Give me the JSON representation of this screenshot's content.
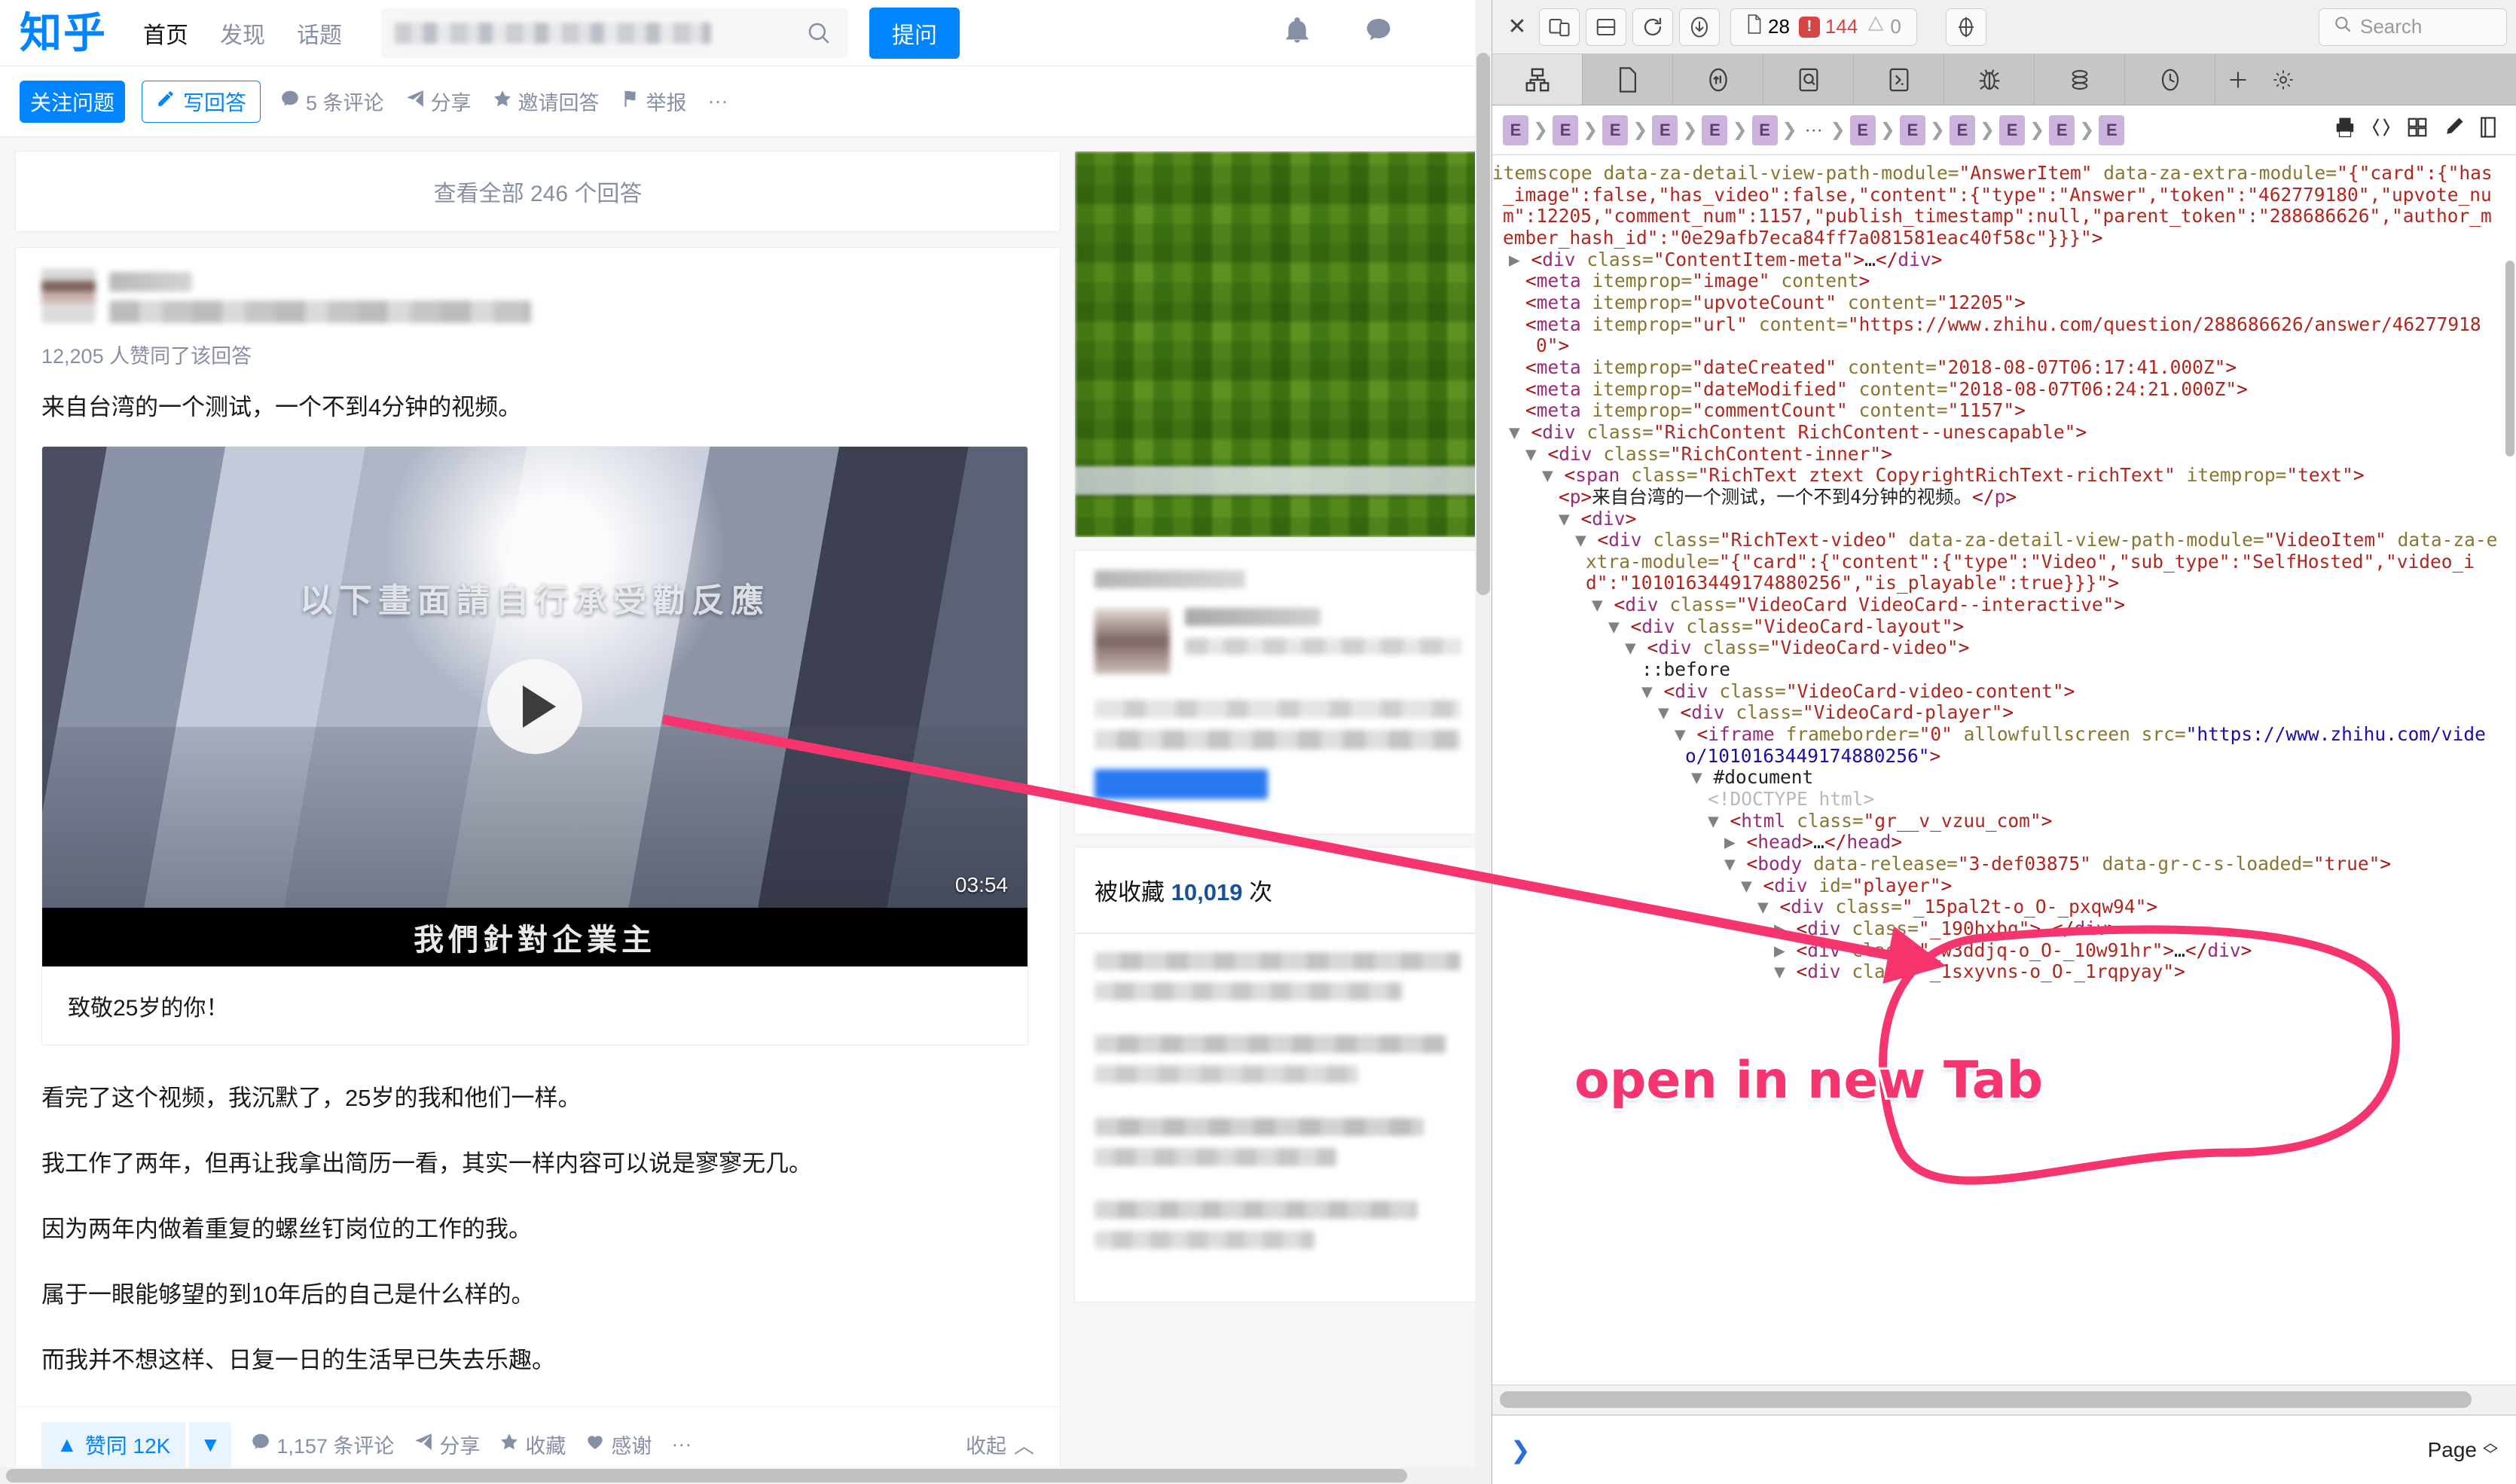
{
  "zhihu": {
    "logo": "知乎",
    "nav": [
      {
        "label": "首页",
        "active": true
      },
      {
        "label": "发现",
        "active": false
      },
      {
        "label": "话题",
        "active": false
      }
    ],
    "search": {
      "placeholder": "",
      "value": ""
    },
    "ask_button": "提问",
    "action_bar": {
      "follow": "关注问题",
      "write": "写回答",
      "comments": "5 条评论",
      "share": "分享",
      "invite": "邀请回答",
      "report": "举报",
      "more": "···"
    },
    "view_all": "查看全部 246 个回答",
    "answer": {
      "upvote_line": "12,205 人赞同了该回答",
      "lead": "来自台湾的一个测试，一个不到4分钟的视频。",
      "video": {
        "overlay_subtitle": "以下畫面請自行承受勸反應",
        "title_bar": "我們針對企業主",
        "duration": "03:54",
        "caption": "致敬25岁的你！"
      },
      "paragraphs": [
        "看完了这个视频，我沉默了，25岁的我和他们一样。",
        "我工作了两年，但再让我拿出简历一看，其实一样内容可以说是寥寥无几。",
        "因为两年内做着重复的螺丝钉岗位的工作的我。",
        "属于一眼能够望的到10年后的自己是什么样的。",
        "而我并不想这样、日复一日的生活早已失去乐趣。"
      ],
      "footer": {
        "upvote": "赞同 12K",
        "comments": "1,157 条评论",
        "share": "分享",
        "favorite": "收藏",
        "thanks": "感谢",
        "more": "···",
        "collapse": "收起"
      }
    },
    "sidebar": {
      "favorited_prefix": "被收藏",
      "favorited_count": "10,019",
      "favorited_suffix": "次"
    }
  },
  "devtools": {
    "toolbar": {
      "close": "✕",
      "docs_count": "28",
      "errors_count": "144",
      "warnings_count": "0",
      "search_placeholder": "Search"
    },
    "tabs": [
      {
        "name": "elements-tab",
        "active": true
      },
      {
        "name": "page-tab",
        "active": false
      },
      {
        "name": "network-tab",
        "active": false
      },
      {
        "name": "search-tab",
        "active": false
      },
      {
        "name": "console-tab",
        "active": false
      },
      {
        "name": "debugger-tab",
        "active": false
      },
      {
        "name": "storage-tab",
        "active": false
      },
      {
        "name": "performance-tab",
        "active": false
      }
    ],
    "breadcrumbs": [
      "E",
      "E",
      "E",
      "E",
      "E",
      "E",
      "...",
      "E",
      "E",
      "E",
      "E",
      "E",
      "E"
    ],
    "dom_lines": [
      {
        "indent": 0,
        "parts": [
          {
            "t": "at",
            "v": "itemscope "
          },
          {
            "t": "at",
            "v": "data-za-detail-view-path-module="
          },
          {
            "t": "av",
            "v": "\"AnswerItem\""
          },
          {
            "t": "at",
            "v": " data-za-extra-module="
          },
          {
            "t": "av",
            "v": "\"{\"card\":{\"has_image\":false,\"has_video\":false,\"content\":{\"type\":\"Answer\",\"token\":\"462779180\",\"upvote_num\":12205,\"comment_num\":1157,\"publish_timestamp\":null,\"parent_token\":\"288686626\",\"author_member_hash_id\":\"0e29afb7eca84ff7a081581eac40f58c\"}}}\""
          },
          {
            "t": "tg",
            "v": ">"
          }
        ]
      },
      {
        "indent": 1,
        "triangle": "right",
        "parts": [
          {
            "t": "tg",
            "v": "<"
          },
          {
            "t": "tn",
            "v": "div "
          },
          {
            "t": "at",
            "v": "class="
          },
          {
            "t": "av",
            "v": "\"ContentItem-meta\""
          },
          {
            "t": "tg",
            "v": ">"
          },
          {
            "t": "tx",
            "v": "…"
          },
          {
            "t": "tg",
            "v": "</"
          },
          {
            "t": "tn",
            "v": "div"
          },
          {
            "t": "tg",
            "v": ">"
          }
        ]
      },
      {
        "indent": 2,
        "parts": [
          {
            "t": "tg",
            "v": "<"
          },
          {
            "t": "tn",
            "v": "meta "
          },
          {
            "t": "at",
            "v": "itemprop="
          },
          {
            "t": "av",
            "v": "\"image\""
          },
          {
            "t": "at",
            "v": " content"
          },
          {
            "t": "tg",
            "v": ">"
          }
        ]
      },
      {
        "indent": 2,
        "parts": [
          {
            "t": "tg",
            "v": "<"
          },
          {
            "t": "tn",
            "v": "meta "
          },
          {
            "t": "at",
            "v": "itemprop="
          },
          {
            "t": "av",
            "v": "\"upvoteCount\""
          },
          {
            "t": "at",
            "v": " content="
          },
          {
            "t": "av",
            "v": "\"12205\""
          },
          {
            "t": "tg",
            "v": ">"
          }
        ]
      },
      {
        "indent": 2,
        "parts": [
          {
            "t": "tg",
            "v": "<"
          },
          {
            "t": "tn",
            "v": "meta "
          },
          {
            "t": "at",
            "v": "itemprop="
          },
          {
            "t": "av",
            "v": "\"url\""
          },
          {
            "t": "at",
            "v": " content="
          },
          {
            "t": "av",
            "v": "\"https://www.zhihu.com/question/288686626/answer/462779180\""
          },
          {
            "t": "tg",
            "v": ">"
          }
        ]
      },
      {
        "indent": 2,
        "parts": [
          {
            "t": "tg",
            "v": "<"
          },
          {
            "t": "tn",
            "v": "meta "
          },
          {
            "t": "at",
            "v": "itemprop="
          },
          {
            "t": "av",
            "v": "\"dateCreated\""
          },
          {
            "t": "at",
            "v": " content="
          },
          {
            "t": "av",
            "v": "\"2018-08-07T06:17:41.000Z\""
          },
          {
            "t": "tg",
            "v": ">"
          }
        ]
      },
      {
        "indent": 2,
        "parts": [
          {
            "t": "tg",
            "v": "<"
          },
          {
            "t": "tn",
            "v": "meta "
          },
          {
            "t": "at",
            "v": "itemprop="
          },
          {
            "t": "av",
            "v": "\"dateModified\""
          },
          {
            "t": "at",
            "v": " content="
          },
          {
            "t": "av",
            "v": "\"2018-08-07T06:24:21.000Z\""
          },
          {
            "t": "tg",
            "v": ">"
          }
        ]
      },
      {
        "indent": 2,
        "parts": [
          {
            "t": "tg",
            "v": "<"
          },
          {
            "t": "tn",
            "v": "meta "
          },
          {
            "t": "at",
            "v": "itemprop="
          },
          {
            "t": "av",
            "v": "\"commentCount\""
          },
          {
            "t": "at",
            "v": " content="
          },
          {
            "t": "av",
            "v": "\"1157\""
          },
          {
            "t": "tg",
            "v": ">"
          }
        ]
      },
      {
        "indent": 1,
        "triangle": "down",
        "parts": [
          {
            "t": "tg",
            "v": "<"
          },
          {
            "t": "tn",
            "v": "div "
          },
          {
            "t": "at",
            "v": "class="
          },
          {
            "t": "av",
            "v": "\"RichContent RichContent--unescapable\""
          },
          {
            "t": "tg",
            "v": ">"
          }
        ]
      },
      {
        "indent": 2,
        "triangle": "down",
        "parts": [
          {
            "t": "tg",
            "v": "<"
          },
          {
            "t": "tn",
            "v": "div "
          },
          {
            "t": "at",
            "v": "class="
          },
          {
            "t": "av",
            "v": "\"RichContent-inner\""
          },
          {
            "t": "tg",
            "v": ">"
          }
        ]
      },
      {
        "indent": 3,
        "triangle": "down",
        "parts": [
          {
            "t": "tg",
            "v": "<"
          },
          {
            "t": "tn",
            "v": "span "
          },
          {
            "t": "at",
            "v": "class="
          },
          {
            "t": "av",
            "v": "\"RichText ztext CopyrightRichText-richText\""
          },
          {
            "t": "at",
            "v": " itemprop="
          },
          {
            "t": "av",
            "v": "\"text\""
          },
          {
            "t": "tg",
            "v": ">"
          }
        ]
      },
      {
        "indent": 4,
        "parts": [
          {
            "t": "tg",
            "v": "<"
          },
          {
            "t": "tn",
            "v": "p"
          },
          {
            "t": "tg",
            "v": ">"
          },
          {
            "t": "tx",
            "v": "来自台湾的一个测试，一个不到4分钟的视频。"
          },
          {
            "t": "tg",
            "v": "</"
          },
          {
            "t": "tn",
            "v": "p"
          },
          {
            "t": "tg",
            "v": ">"
          }
        ]
      },
      {
        "indent": 4,
        "triangle": "down",
        "parts": [
          {
            "t": "tg",
            "v": "<"
          },
          {
            "t": "tn",
            "v": "div"
          },
          {
            "t": "tg",
            "v": ">"
          }
        ]
      },
      {
        "indent": 5,
        "triangle": "down",
        "parts": [
          {
            "t": "tg",
            "v": "<"
          },
          {
            "t": "tn",
            "v": "div "
          },
          {
            "t": "at",
            "v": "class="
          },
          {
            "t": "av",
            "v": "\"RichText-video\""
          },
          {
            "t": "at",
            "v": " data-za-detail-view-path-module="
          },
          {
            "t": "av",
            "v": "\"VideoItem\""
          },
          {
            "t": "at",
            "v": " data-za-extra-module="
          },
          {
            "t": "av",
            "v": "\"{\"card\":{\"content\":{\"type\":\"Video\",\"sub_type\":\"SelfHosted\",\"video_id\":\"1010163449174880256\",\"is_playable\":true}}}\""
          },
          {
            "t": "tg",
            "v": ">"
          }
        ]
      },
      {
        "indent": 6,
        "triangle": "down",
        "parts": [
          {
            "t": "tg",
            "v": "<"
          },
          {
            "t": "tn",
            "v": "div "
          },
          {
            "t": "at",
            "v": "class="
          },
          {
            "t": "av",
            "v": "\"VideoCard VideoCard--interactive\""
          },
          {
            "t": "tg",
            "v": ">"
          }
        ]
      },
      {
        "indent": 7,
        "triangle": "down",
        "parts": [
          {
            "t": "tg",
            "v": "<"
          },
          {
            "t": "tn",
            "v": "div "
          },
          {
            "t": "at",
            "v": "class="
          },
          {
            "t": "av",
            "v": "\"VideoCard-layout\""
          },
          {
            "t": "tg",
            "v": ">"
          }
        ]
      },
      {
        "indent": 8,
        "triangle": "down",
        "parts": [
          {
            "t": "tg",
            "v": "<"
          },
          {
            "t": "tn",
            "v": "div "
          },
          {
            "t": "at",
            "v": "class="
          },
          {
            "t": "av",
            "v": "\"VideoCard-video\""
          },
          {
            "t": "tg",
            "v": ">"
          }
        ]
      },
      {
        "indent": 9,
        "parts": [
          {
            "t": "tx",
            "v": "::before"
          }
        ]
      },
      {
        "indent": 9,
        "triangle": "down",
        "parts": [
          {
            "t": "tg",
            "v": "<"
          },
          {
            "t": "tn",
            "v": "div "
          },
          {
            "t": "at",
            "v": "class="
          },
          {
            "t": "av",
            "v": "\"VideoCard-video-content\""
          },
          {
            "t": "tg",
            "v": ">"
          }
        ]
      },
      {
        "indent": 10,
        "triangle": "down",
        "parts": [
          {
            "t": "tg",
            "v": "<"
          },
          {
            "t": "tn",
            "v": "div "
          },
          {
            "t": "at",
            "v": "class="
          },
          {
            "t": "av",
            "v": "\"VideoCard-player\""
          },
          {
            "t": "tg",
            "v": ">"
          }
        ]
      },
      {
        "indent": 11,
        "triangle": "down",
        "parts": [
          {
            "t": "tg",
            "v": "<"
          },
          {
            "t": "tn",
            "v": "iframe "
          },
          {
            "t": "at",
            "v": "frameborder="
          },
          {
            "t": "av",
            "v": "\"0\""
          },
          {
            "t": "at",
            "v": " allowfullscreen src="
          },
          {
            "t": "lk",
            "v": "\"https://www.zhihu.com/video/1010163449174880256\""
          },
          {
            "t": "tg",
            "v": ">"
          }
        ]
      },
      {
        "indent": 12,
        "triangle": "down",
        "parts": [
          {
            "t": "tx",
            "v": "#document"
          }
        ]
      },
      {
        "indent": 13,
        "parts": [
          {
            "t": "cm",
            "v": "<!DOCTYPE html>"
          }
        ]
      },
      {
        "indent": 13,
        "triangle": "down",
        "parts": [
          {
            "t": "tg",
            "v": "<"
          },
          {
            "t": "tn",
            "v": "html "
          },
          {
            "t": "at",
            "v": "class="
          },
          {
            "t": "av",
            "v": "\"gr__v_vzuu_com\""
          },
          {
            "t": "tg",
            "v": ">"
          }
        ]
      },
      {
        "indent": 14,
        "triangle": "right",
        "parts": [
          {
            "t": "tg",
            "v": "<"
          },
          {
            "t": "tn",
            "v": "head"
          },
          {
            "t": "tg",
            "v": ">"
          },
          {
            "t": "tx",
            "v": "…"
          },
          {
            "t": "tg",
            "v": "</"
          },
          {
            "t": "tn",
            "v": "head"
          },
          {
            "t": "tg",
            "v": ">"
          }
        ]
      },
      {
        "indent": 14,
        "triangle": "down",
        "parts": [
          {
            "t": "tg",
            "v": "<"
          },
          {
            "t": "tn",
            "v": "body "
          },
          {
            "t": "at",
            "v": "data-release="
          },
          {
            "t": "av",
            "v": "\"3-def03875\""
          },
          {
            "t": "at",
            "v": " data-gr-c-s-loaded="
          },
          {
            "t": "av",
            "v": "\"true\""
          },
          {
            "t": "tg",
            "v": ">"
          }
        ]
      },
      {
        "indent": 15,
        "triangle": "down",
        "parts": [
          {
            "t": "tg",
            "v": "<"
          },
          {
            "t": "tn",
            "v": "div "
          },
          {
            "t": "at",
            "v": "id="
          },
          {
            "t": "av",
            "v": "\"player\""
          },
          {
            "t": "tg",
            "v": ">"
          }
        ]
      },
      {
        "indent": 16,
        "triangle": "down",
        "parts": [
          {
            "t": "tg",
            "v": "<"
          },
          {
            "t": "tn",
            "v": "div "
          },
          {
            "t": "at",
            "v": "class="
          },
          {
            "t": "av",
            "v": "\"_15pal2t-o_O-_pxqw94\""
          },
          {
            "t": "tg",
            "v": ">"
          }
        ]
      },
      {
        "indent": 17,
        "triangle": "right",
        "parts": [
          {
            "t": "tg",
            "v": "<"
          },
          {
            "t": "tn",
            "v": "div "
          },
          {
            "t": "at",
            "v": "class="
          },
          {
            "t": "av",
            "v": "\"_190hxbq\""
          },
          {
            "t": "tg",
            "v": ">"
          },
          {
            "t": "tx",
            "v": "…"
          },
          {
            "t": "tg",
            "v": "</"
          },
          {
            "t": "tn",
            "v": "div"
          },
          {
            "t": "tg",
            "v": ">"
          }
        ]
      },
      {
        "indent": 17,
        "triangle": "right",
        "parts": [
          {
            "t": "tg",
            "v": "<"
          },
          {
            "t": "tn",
            "v": "div "
          },
          {
            "t": "at",
            "v": "class="
          },
          {
            "t": "av",
            "v": "\"_w3ddjq-o_O-_10w91hr\""
          },
          {
            "t": "tg",
            "v": ">"
          },
          {
            "t": "tx",
            "v": "…"
          },
          {
            "t": "tg",
            "v": "</"
          },
          {
            "t": "tn",
            "v": "div"
          },
          {
            "t": "tg",
            "v": ">"
          }
        ]
      },
      {
        "indent": 17,
        "triangle": "down",
        "parts": [
          {
            "t": "tg",
            "v": "<"
          },
          {
            "t": "tn",
            "v": "div "
          },
          {
            "t": "at",
            "v": "class="
          },
          {
            "t": "av",
            "v": "\"_1sxyvns-o_O-_1rqpyay\""
          },
          {
            "t": "tg",
            "v": ">"
          }
        ]
      }
    ],
    "status": {
      "prompt": "❯",
      "page_label": "Page"
    }
  },
  "annotation": {
    "text": "open in new Tab",
    "color": "#f6356e"
  }
}
